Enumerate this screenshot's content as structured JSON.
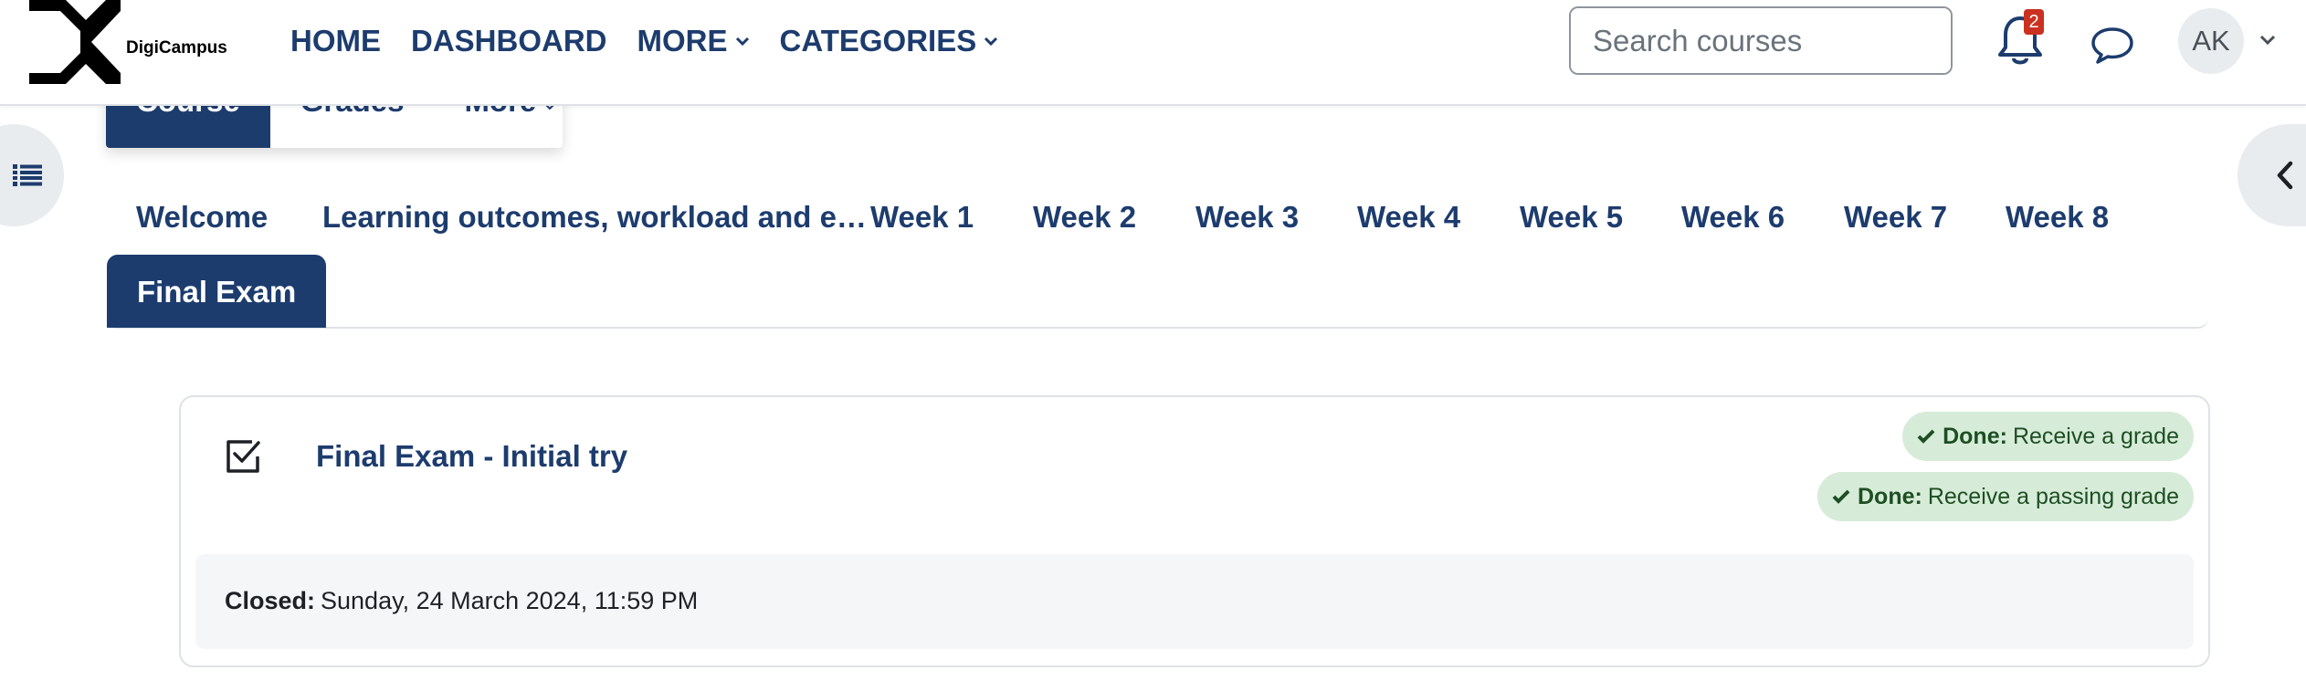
{
  "brand": {
    "name": "DigiCampus"
  },
  "primary_nav": [
    {
      "label": "HOME"
    },
    {
      "label": "DASHBOARD"
    },
    {
      "label": "MORE",
      "has_dropdown": true
    },
    {
      "label": "CATEGORIES",
      "has_dropdown": true
    }
  ],
  "search": {
    "placeholder": "Search courses",
    "button_icon": "search-icon"
  },
  "notifications": {
    "count": "2",
    "icon": "bell-icon"
  },
  "messages": {
    "icon": "chat-icon"
  },
  "user": {
    "initials": "AK"
  },
  "secondary_nav": [
    {
      "label": "Course",
      "active": true
    },
    {
      "label": "Grades",
      "active": false
    },
    {
      "label": "More",
      "active": false,
      "has_dropdown": true
    }
  ],
  "section_tabs": [
    {
      "label": "Welcome"
    },
    {
      "label": "Learning outcomes, workload and e…"
    },
    {
      "label": "Week 1"
    },
    {
      "label": "Week 2"
    },
    {
      "label": "Week 3"
    },
    {
      "label": "Week 4"
    },
    {
      "label": "Week 5"
    },
    {
      "label": "Week 6"
    },
    {
      "label": "Week 7"
    },
    {
      "label": "Week 8"
    },
    {
      "label": "Final Exam",
      "active": true
    }
  ],
  "activity": {
    "title": "Final Exam - Initial try",
    "icon": "checkbox-checked-icon",
    "completion": [
      {
        "status": "Done:",
        "text": "Receive a grade"
      },
      {
        "status": "Done:",
        "text": "Receive a passing grade"
      }
    ],
    "dates": {
      "label": "Closed:",
      "value": "Sunday, 24 March 2024, 11:59 PM"
    }
  },
  "colors": {
    "primary": "#1d3c6e",
    "badge": "#ca3120",
    "done_bg": "#d7ebd9",
    "done_text": "#1c4f22",
    "drawer_bg": "#e9ecef"
  }
}
